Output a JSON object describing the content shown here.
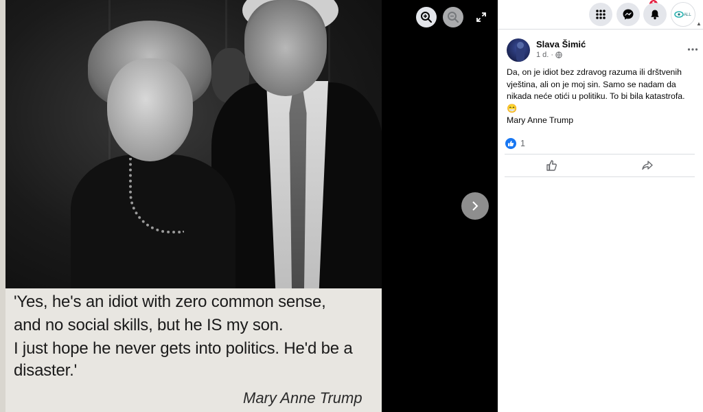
{
  "viewer": {
    "quote_lines": [
      "'Yes, he's an idiot with zero common sense,",
      "and no social skills, but he IS my son.",
      "I just hope he never gets into politics. He'd be a",
      "disaster.'"
    ],
    "quote_signature": "Mary Anne Trump",
    "controls": {
      "zoom_in_icon": "zoom-in-icon",
      "zoom_out_icon": "zoom-out-icon",
      "expand_icon": "expand-icon",
      "next_icon": "chevron-right-icon"
    }
  },
  "topbar": {
    "menu_icon": "grid-menu-icon",
    "messenger_icon": "messenger-icon",
    "messenger_badge": "1",
    "notifications_icon": "bell-icon",
    "profile_logo_text": "ALL"
  },
  "post": {
    "author": "Slava Šimić",
    "time": "1 d.",
    "audience_icon": "globe-icon",
    "more_icon": "more-icon",
    "text_lines": [
      "Da, on je idiot bez zdravog razuma ili drštvenih",
      "vještina, ali on je moj sin. Samo se nadam da",
      "nikada neće otići u politiku. To bi bila katastrofa.",
      "😁",
      "Mary Anne Trump"
    ],
    "reaction_count": "1",
    "actions": {
      "like_icon": "thumbs-up-icon",
      "share_icon": "share-icon"
    }
  },
  "colors": {
    "accent": "#1877f2",
    "badge": "#e41e3f",
    "panel_bg": "#ffffff",
    "viewer_bg": "#000000"
  }
}
